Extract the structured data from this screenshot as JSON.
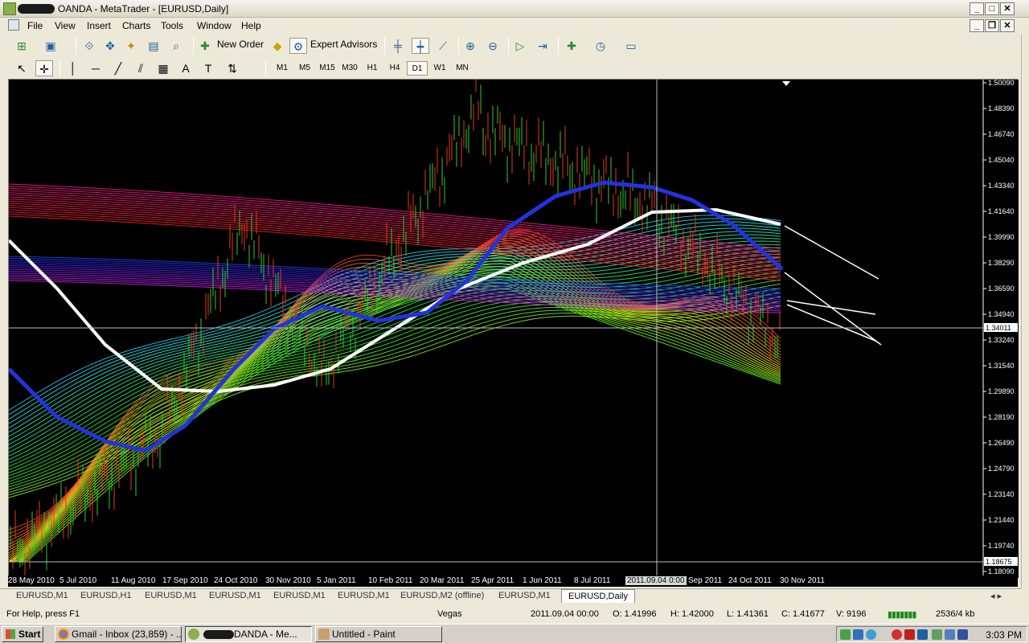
{
  "window": {
    "title": "OANDA - MetaTrader - [EURUSD,Daily]",
    "controls": [
      "_",
      "□",
      "✕"
    ]
  },
  "menu": [
    "File",
    "View",
    "Insert",
    "Charts",
    "Tools",
    "Window",
    "Help"
  ],
  "toolbar": {
    "new_order": "New Order",
    "expert_advisors": "Expert Advisors"
  },
  "timeframes": [
    "M1",
    "M5",
    "M15",
    "M30",
    "H1",
    "H4",
    "D1",
    "W1",
    "MN"
  ],
  "active_timeframe": "D1",
  "chart": {
    "symbol": "EURUSD,Daily",
    "price_levels": [
      "1.50090",
      "1.48390",
      "1.46740",
      "1.45040",
      "1.43340",
      "1.41640",
      "1.39990",
      "1.38290",
      "1.36590",
      "1.34940",
      "1.33240",
      "1.31540",
      "1.29890",
      "1.28190",
      "1.26490",
      "1.24790",
      "1.23140",
      "1.21440",
      "1.19740",
      "1.18090"
    ],
    "current_price": "1.34011",
    "cursor_price": "1.18675",
    "dates": [
      "28 May 2010",
      "5 Jul 2010",
      "11 Aug 2010",
      "17 Sep 2010",
      "24 Oct 2010",
      "30 Nov 2010",
      "5 Jan 2011",
      "10 Feb 2011",
      "20 Mar 2011",
      "25 Apr 2011",
      "1 Jun 2011",
      "8 Jul 2011",
      "Sep 2011",
      "24 Oct 2011",
      "30 Nov 2011"
    ],
    "cursor_date": "2011.09.04 0:00",
    "colors": {
      "background": "#000000",
      "white_ma": "#ffffff",
      "blue_ma": "#2233dd"
    }
  },
  "tabs": [
    "EURUSD,M1",
    "EURUSD,H1",
    "EURUSD,M1",
    "EURUSD,M1",
    "EURUSD,M1",
    "EURUSD,M1",
    "EURUSD,M2 (offline)",
    "EURUSD,M1",
    "EURUSD,Daily"
  ],
  "active_tab": "EURUSD,Daily",
  "status": {
    "help": "For Help, press F1",
    "profile": "Vegas",
    "datetime": "2011.09.04 00:00",
    "open": "O: 1.41996",
    "high": "H: 1.42000",
    "low": "L: 1.41361",
    "close": "C: 1.41677",
    "volume": "V: 9196",
    "traffic": "2536/4 kb"
  },
  "taskbar": {
    "start": "Start",
    "items": [
      "Gmail - Inbox (23,859) - ...",
      "DANDA - Me...",
      "Untitled - Paint"
    ],
    "clock": "3:03 PM"
  }
}
